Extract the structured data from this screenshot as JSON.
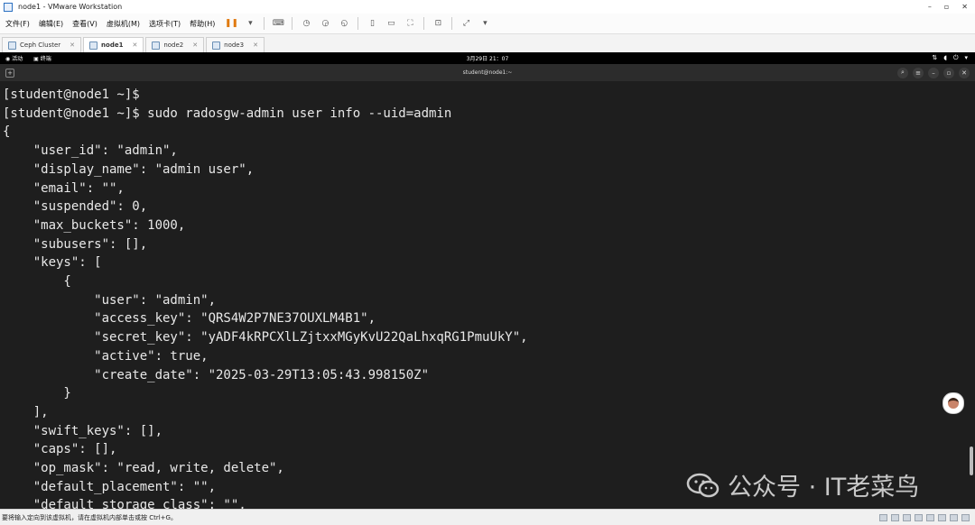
{
  "window": {
    "title": "node1 - VMware Workstation",
    "controls": [
      "–",
      "▫",
      "✕"
    ]
  },
  "menubar": {
    "items": [
      "文件(F)",
      "编辑(E)",
      "查看(V)",
      "虚拟机(M)",
      "选项卡(T)",
      "帮助(H)"
    ]
  },
  "tabs": [
    {
      "label": "Ceph Cluster"
    },
    {
      "label": "node1"
    },
    {
      "label": "node2"
    },
    {
      "label": "node3"
    }
  ],
  "gnome": {
    "activities": "活动",
    "terminal_app": "终端",
    "clock": "3月29日 21：07"
  },
  "terminal": {
    "title": "student@node1:~",
    "lines": [
      "[student@node1 ~]$",
      "[student@node1 ~]$ sudo radosgw-admin user info --uid=admin",
      "{",
      "    \"user_id\": \"admin\",",
      "    \"display_name\": \"admin user\",",
      "    \"email\": \"\",",
      "    \"suspended\": 0,",
      "    \"max_buckets\": 1000,",
      "    \"subusers\": [],",
      "    \"keys\": [",
      "        {",
      "            \"user\": \"admin\",",
      "            \"access_key\": \"QRS4W2P7NE37OUXLM4B1\",",
      "            \"secret_key\": \"yADF4kRPCXlLZjtxxMGyKvU22QaLhxqRG1PmuUkY\",",
      "            \"active\": true,",
      "            \"create_date\": \"2025-03-29T13:05:43.998150Z\"",
      "        }",
      "    ],",
      "    \"swift_keys\": [],",
      "    \"caps\": [],",
      "    \"op_mask\": \"read, write, delete\",",
      "    \"default_placement\": \"\",",
      "    \"default_storage_class\": \"\","
    ]
  },
  "watermark": {
    "text": "公众号 · IT老菜鸟"
  },
  "statusbar": {
    "message": "要将输入定向到该虚拟机，请在虚拟机内部单击或按 Ctrl+G。"
  }
}
